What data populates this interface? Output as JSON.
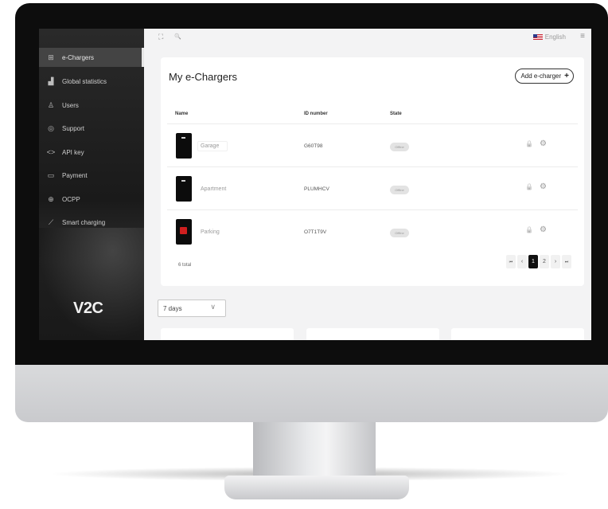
{
  "sidebar": {
    "items": [
      {
        "label": "e-Chargers",
        "icon": "charger-icon",
        "glyph": "⊞"
      },
      {
        "label": "Global statistics",
        "icon": "bar-chart-icon",
        "glyph": "▟"
      },
      {
        "label": "Users",
        "icon": "user-icon",
        "glyph": "♙"
      },
      {
        "label": "Support",
        "icon": "support-icon",
        "glyph": "◎"
      },
      {
        "label": "API key",
        "icon": "code-icon",
        "glyph": "<>"
      },
      {
        "label": "Payment",
        "icon": "payment-icon",
        "glyph": "▭"
      },
      {
        "label": "OCPP",
        "icon": "globe-icon",
        "glyph": "⊕"
      },
      {
        "label": "Smart charging",
        "icon": "leaf-icon",
        "glyph": "⟋"
      }
    ],
    "logo": "V2C"
  },
  "topbar": {
    "expand_glyph": "⛶",
    "search_glyph": "🔍",
    "language": "English",
    "menu_glyph": "≡"
  },
  "main": {
    "title": "My e-Chargers",
    "add_button": "Add e-charger",
    "add_button_icon": "+",
    "columns": [
      "Name",
      "ID number",
      "State"
    ],
    "rows": [
      {
        "name": "Garage",
        "id": "G60T98",
        "state": "Offline",
        "device": "black"
      },
      {
        "name": "Apartment",
        "id": "PLUMHCV",
        "state": "Offline",
        "device": "black"
      },
      {
        "name": "Parking",
        "id": "O7T1T9V",
        "state": "Offline",
        "device": "red"
      }
    ],
    "lock_glyph": "🔒",
    "settings_glyph": "⚙",
    "total": "6 total",
    "pager": {
      "first": "⏮",
      "prev": "‹",
      "pages": [
        "1",
        "2"
      ],
      "next": "›",
      "last": "⏭"
    }
  },
  "period": {
    "value": "7 days",
    "chevron": "∨"
  }
}
